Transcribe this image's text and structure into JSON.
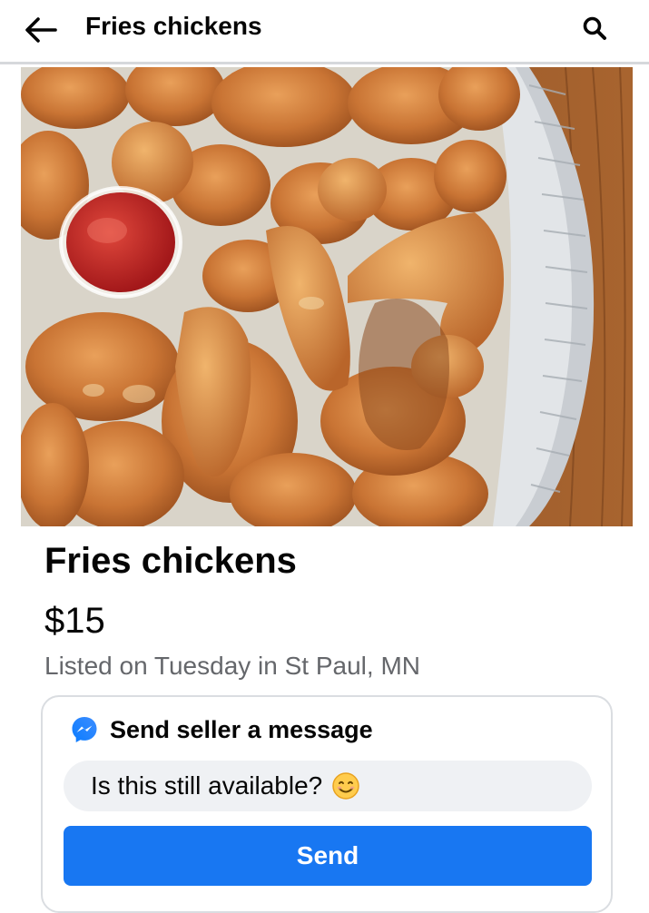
{
  "header": {
    "title": "Fries chickens",
    "back_icon": "arrow-left-icon",
    "search_icon": "search-icon"
  },
  "listing": {
    "title": "Fries chickens",
    "price": "$15",
    "meta": "Listed on Tuesday in St Paul, MN"
  },
  "message": {
    "header_label": "Send seller a message",
    "header_icon": "messenger-icon",
    "input_value": "Is this still available?",
    "emoji": "smiling-face-icon",
    "send_label": "Send"
  },
  "colors": {
    "accent": "#1877f2",
    "text_primary": "#050505",
    "text_secondary": "#65676b",
    "input_bg": "#eff1f4"
  }
}
